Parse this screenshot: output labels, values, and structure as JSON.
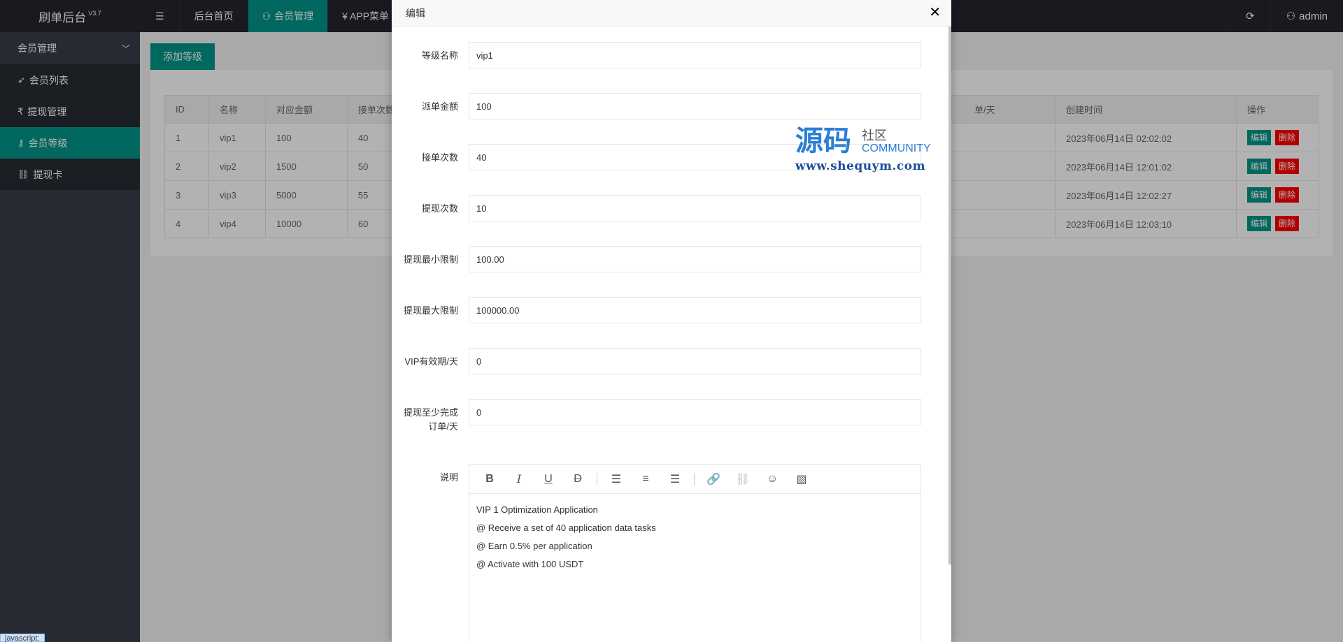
{
  "header": {
    "logo": "刷单后台",
    "version": "V3.7",
    "nav": [
      {
        "label": "",
        "icon": "menu-toggle-icon"
      },
      {
        "label": "后台首页"
      },
      {
        "label": "会员管理",
        "icon": "user-icon",
        "active": true
      },
      {
        "label": "¥ APP菜单"
      }
    ],
    "refresh_icon": "refresh-icon",
    "user": "admin"
  },
  "sidebar": {
    "group": "会员管理",
    "items": [
      {
        "label": "会员列表",
        "icon": "rocket-icon"
      },
      {
        "label": "提现管理",
        "icon": "rupee-icon"
      },
      {
        "label": "会员等级",
        "icon": "key-icon",
        "active": true
      },
      {
        "label": "提现卡",
        "icon": "link-icon"
      }
    ]
  },
  "content": {
    "add_button": "添加等级",
    "table": {
      "headers": [
        "ID",
        "名称",
        "对应金额",
        "接单次数",
        "单/天",
        "创建时间",
        "操作"
      ],
      "rows": [
        {
          "id": "1",
          "name": "vip1",
          "amount": "100",
          "orders": "40",
          "created": "2023年06月14日 02:02:02"
        },
        {
          "id": "2",
          "name": "vip2",
          "amount": "1500",
          "orders": "50",
          "created": "2023年06月14日 12:01:02"
        },
        {
          "id": "3",
          "name": "vip3",
          "amount": "5000",
          "orders": "55",
          "created": "2023年06月14日 12:02:27"
        },
        {
          "id": "4",
          "name": "vip4",
          "amount": "10000",
          "orders": "60",
          "created": "2023年06月14日 12:03:10"
        }
      ],
      "edit_label": "编辑",
      "delete_label": "删除"
    }
  },
  "modal": {
    "title": "编辑",
    "fields": [
      {
        "label": "等级名称",
        "value": "vip1"
      },
      {
        "label": "派单金额",
        "value": "100"
      },
      {
        "label": "接单次数",
        "value": "40"
      },
      {
        "label": "提现次数",
        "value": "10"
      },
      {
        "label": "提现最小限制",
        "value": "100.00"
      },
      {
        "label": "提现最大限制",
        "value": "100000.00"
      },
      {
        "label": "VIP有效期/天",
        "value": "0"
      },
      {
        "label": "提现至少完成订单/天",
        "label_line1": "提现至少完成",
        "label_line2": "订单/天",
        "value": "0"
      }
    ],
    "description_label": "说明",
    "description_lines": [
      "VIP 1 Optimization Application",
      "@ Receive a set of 40 application data tasks",
      "@ Earn 0.5% per application",
      "@ Activate with 100 USDT"
    ]
  },
  "watermark": {
    "big": "源码",
    "small": "社区",
    "community": "COMMUNITY",
    "url": "www.shequym.com"
  },
  "status_tip": "javascript:"
}
